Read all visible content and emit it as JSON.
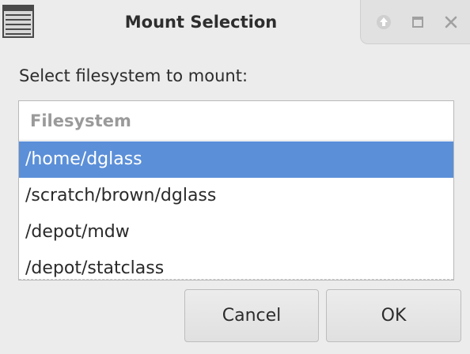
{
  "window": {
    "title": "Mount Selection",
    "icon": "list-window-icon",
    "controls": [
      "up-arrow-icon",
      "maximize-icon",
      "close-icon"
    ]
  },
  "prompt": "Select filesystem to mount:",
  "list": {
    "column_header": "Filesystem",
    "rows": [
      {
        "label": "/home/dglass",
        "selected": true
      },
      {
        "label": "/scratch/brown/dglass",
        "selected": false
      },
      {
        "label": "/depot/mdw",
        "selected": false
      },
      {
        "label": "/depot/statclass",
        "selected": false
      }
    ]
  },
  "buttons": {
    "cancel": "Cancel",
    "ok": "OK"
  },
  "colors": {
    "selection": "#5b8fd8",
    "header_text": "#9a9a9a",
    "background": "#ececec"
  }
}
